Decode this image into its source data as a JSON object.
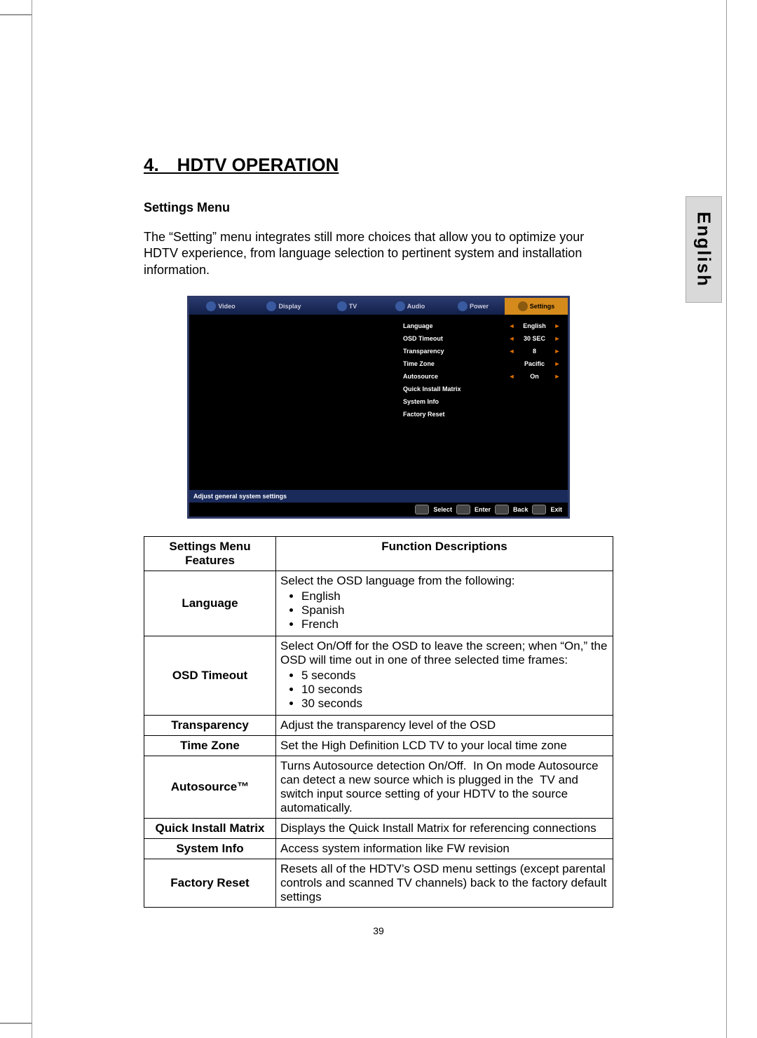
{
  "side_tab": "English",
  "section_title": "4. HDTV OPERATION",
  "sub_heading": "Settings Menu",
  "intro_text": "The “Setting” menu integrates still more choices that allow you to optimize your HDTV experience, from language selection to pertinent system and installation information.",
  "osd": {
    "tabs": [
      "Video",
      "Display",
      "TV",
      "Audio",
      "Power",
      "Settings"
    ],
    "active_tab": "Settings",
    "rows": [
      {
        "label": "Language",
        "value": "English",
        "arrows": true
      },
      {
        "label": "OSD Timeout",
        "value": "30 SEC",
        "arrows": true
      },
      {
        "label": "Transparency",
        "value": "8",
        "arrows": true
      },
      {
        "label": "Time Zone",
        "value": "Pacific",
        "arrows": true,
        "rightOnly": true
      },
      {
        "label": "Autosource",
        "value": "On",
        "arrows": true
      },
      {
        "label": "Quick Install Matrix",
        "value": "",
        "arrows": false
      },
      {
        "label": "System Info",
        "value": "",
        "arrows": false
      },
      {
        "label": "Factory Reset",
        "value": "",
        "arrows": false
      }
    ],
    "hint": "Adjust general system settings",
    "footer": [
      "Select",
      "Enter",
      "Back",
      "Exit"
    ]
  },
  "table": {
    "head_left": "Settings Menu Features",
    "head_right": "Function Descriptions",
    "rows": [
      {
        "feature": "Language",
        "desc": "Select the OSD language from the following:",
        "bullets": [
          "English",
          "Spanish",
          "French"
        ]
      },
      {
        "feature": "OSD Timeout",
        "desc": "Select On/Off for the OSD to leave the screen; when “On,” the OSD will time out in one of three selected time frames:",
        "bullets": [
          "5 seconds",
          "10 seconds",
          "30 seconds"
        ]
      },
      {
        "feature": "Transparency",
        "desc": "Adjust the transparency level of the OSD"
      },
      {
        "feature": "Time Zone",
        "desc": "Set the High Definition LCD TV to your local time zone"
      },
      {
        "feature": "Autosource™",
        "desc": "Turns Autosource detection On/Off.  In On mode Autosource can detect a new source which is plugged in the  TV and switch input source setting of your HDTV to the source automatically."
      },
      {
        "feature": "Quick Install Matrix",
        "desc": "Displays the Quick Install Matrix for referencing connections"
      },
      {
        "feature": "System Info",
        "desc": "Access system information like FW revision"
      },
      {
        "feature": "Factory Reset",
        "desc": "Resets all of the HDTV’s OSD menu settings (except parental controls and scanned TV channels) back to the factory default settings"
      }
    ]
  },
  "page_number": "39"
}
